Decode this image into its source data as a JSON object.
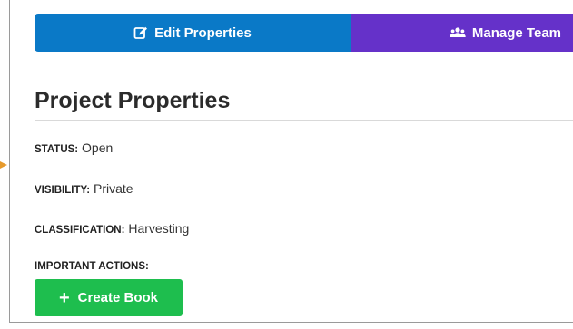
{
  "tabs": {
    "edit_label": "Edit Properties",
    "edit_icon": "edit-icon",
    "edit_color": "#0a79c7",
    "team_label": "Manage Team",
    "team_icon": "users-icon",
    "team_color": "#6531c9"
  },
  "page_title": "Project Properties",
  "properties": [
    {
      "key": "STATUS:",
      "value": "Open"
    },
    {
      "key": "VISIBILITY:",
      "value": "Private"
    },
    {
      "key": "CLASSIFICATION:",
      "value": "Harvesting"
    }
  ],
  "actions": {
    "heading": "IMPORTANT ACTIONS:",
    "create_book_label": "Create Book",
    "create_book_icon": "plus-icon",
    "create_book_color": "#1ebe4e"
  }
}
